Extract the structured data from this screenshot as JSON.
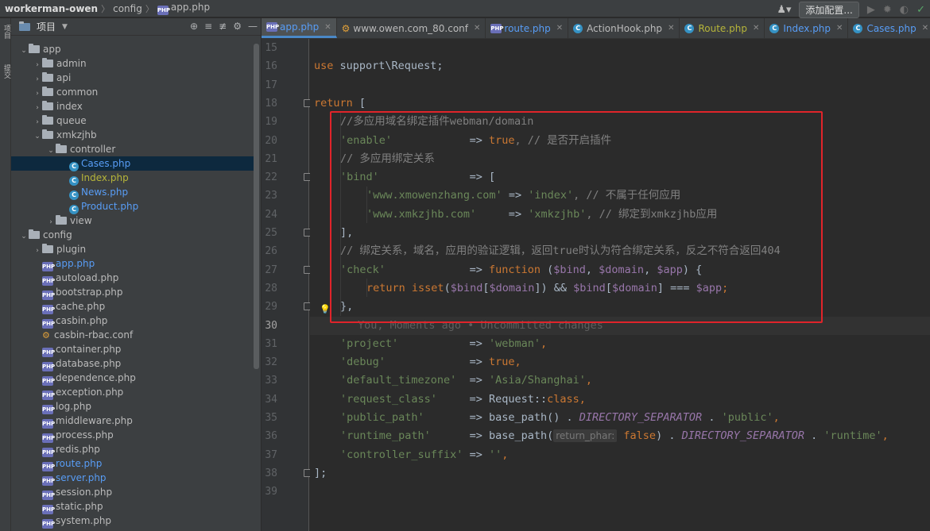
{
  "breadcrumb": [
    "workerman-owen",
    "config",
    "app.php"
  ],
  "toolbar": {
    "add_config_label": "添加配置..."
  },
  "toolstrip": {
    "project_tab": "项目",
    "commit_tab": "提交"
  },
  "project_panel": {
    "title": "项目",
    "tree": [
      {
        "label": "app",
        "type": "folder",
        "depth": 1,
        "expanded": true
      },
      {
        "label": "admin",
        "type": "folder",
        "depth": 2,
        "expanded": false
      },
      {
        "label": "api",
        "type": "folder",
        "depth": 2,
        "expanded": false
      },
      {
        "label": "common",
        "type": "folder",
        "depth": 2,
        "expanded": false
      },
      {
        "label": "index",
        "type": "folder",
        "depth": 2,
        "expanded": false
      },
      {
        "label": "queue",
        "type": "folder",
        "depth": 2,
        "expanded": false
      },
      {
        "label": "xmkzjhb",
        "type": "folder",
        "depth": 2,
        "expanded": true
      },
      {
        "label": "controller",
        "type": "folder",
        "depth": 3,
        "expanded": true
      },
      {
        "label": "Cases.php",
        "type": "class",
        "depth": 4,
        "selected": true,
        "color": "blue"
      },
      {
        "label": "Index.php",
        "type": "class",
        "depth": 4,
        "color": "yellow"
      },
      {
        "label": "News.php",
        "type": "class",
        "depth": 4,
        "color": "blue"
      },
      {
        "label": "Product.php",
        "type": "class",
        "depth": 4,
        "color": "blue"
      },
      {
        "label": "view",
        "type": "folder",
        "depth": 3,
        "expanded": false
      },
      {
        "label": "config",
        "type": "folder",
        "depth": 1,
        "expanded": true
      },
      {
        "label": "plugin",
        "type": "folder",
        "depth": 2,
        "expanded": false
      },
      {
        "label": "app.php",
        "type": "php",
        "depth": 2,
        "color": "blue"
      },
      {
        "label": "autoload.php",
        "type": "php",
        "depth": 2
      },
      {
        "label": "bootstrap.php",
        "type": "php",
        "depth": 2
      },
      {
        "label": "cache.php",
        "type": "php",
        "depth": 2
      },
      {
        "label": "casbin.php",
        "type": "php",
        "depth": 2
      },
      {
        "label": "casbin-rbac.conf",
        "type": "conf",
        "depth": 2
      },
      {
        "label": "container.php",
        "type": "php",
        "depth": 2
      },
      {
        "label": "database.php",
        "type": "php",
        "depth": 2
      },
      {
        "label": "dependence.php",
        "type": "php",
        "depth": 2
      },
      {
        "label": "exception.php",
        "type": "php",
        "depth": 2
      },
      {
        "label": "log.php",
        "type": "php",
        "depth": 2
      },
      {
        "label": "middleware.php",
        "type": "php",
        "depth": 2
      },
      {
        "label": "process.php",
        "type": "php",
        "depth": 2
      },
      {
        "label": "redis.php",
        "type": "php",
        "depth": 2
      },
      {
        "label": "route.php",
        "type": "php",
        "depth": 2,
        "color": "blue"
      },
      {
        "label": "server.php",
        "type": "php",
        "depth": 2,
        "color": "blue"
      },
      {
        "label": "session.php",
        "type": "php",
        "depth": 2
      },
      {
        "label": "static.php",
        "type": "php",
        "depth": 2
      },
      {
        "label": "system.php",
        "type": "php",
        "depth": 2
      }
    ]
  },
  "tabs": [
    {
      "label": "app.php",
      "icon": "php",
      "active": true,
      "color": "blue"
    },
    {
      "label": "www.owen.com_80.conf",
      "icon": "conf",
      "color": "normal"
    },
    {
      "label": "route.php",
      "icon": "php",
      "color": "blue"
    },
    {
      "label": "ActionHook.php",
      "icon": "class",
      "color": "normal"
    },
    {
      "label": "Route.php",
      "icon": "class",
      "color": "olive"
    },
    {
      "label": "Index.php",
      "icon": "class",
      "color": "blue"
    },
    {
      "label": "Cases.php",
      "icon": "class",
      "color": "blue"
    }
  ],
  "editor": {
    "current_line": 30,
    "line_numbers": [
      15,
      16,
      17,
      18,
      19,
      20,
      21,
      22,
      23,
      24,
      25,
      26,
      27,
      28,
      29,
      30,
      31,
      32,
      33,
      34,
      35,
      36,
      37,
      38,
      39
    ],
    "code": {
      "l16_use": "use",
      "l16_ns": " support\\Request;",
      "l18_return": "return",
      "l18_bracket": " [",
      "l19": "//多应用域名绑定插件webman/domain",
      "l20_key": "'enable'",
      "l20_arrow": "            => ",
      "l20_val": "true",
      "l20_cmt": ", // 是否开启插件",
      "l21": "// 多应用绑定关系",
      "l22_key": "'bind'",
      "l22_rest": "              => [",
      "l23_key": "'www.xmowenzhang.com'",
      "l23_arrow": " => ",
      "l23_val": "'index'",
      "l23_cmt": ", // 不属于任何应用",
      "l24_key": "'www.xmkzjhb.com'",
      "l24_arrow": "     => ",
      "l24_val": "'xmkzjhb'",
      "l24_cmt": ", // 绑定到xmkzjhb应用",
      "l25": "],",
      "l26": "// 绑定关系，域名，应用的验证逻辑，返回true时认为符合绑定关系，反之不符合返回404",
      "l27_key": "'check'",
      "l27_arrow": "             => ",
      "l27_fn": "function",
      "l27_open": " (",
      "l27_v1": "$bind",
      "l27_c1": ", ",
      "l27_v2": "$domain",
      "l27_c2": ", ",
      "l27_v3": "$app",
      "l27_close": ") {",
      "l28_return": "return",
      "l28_isset": " isset",
      "l28_a": "(",
      "l28_v1": "$bind",
      "l28_b": "[",
      "l28_v2": "$domain",
      "l28_c": "]) && ",
      "l28_v3": "$bind",
      "l28_d": "[",
      "l28_v4": "$domain",
      "l28_e": "] === ",
      "l28_v5": "$app",
      "l28_f": ";",
      "l29": "},",
      "l30_blame": "You, Moments ago • Uncommitted changes",
      "l31_key": "'project'",
      "l31_arrow": "           => ",
      "l31_val": "'webman'",
      "l31_end": ",",
      "l32_key": "'debug'",
      "l32_arrow": "             => ",
      "l32_val": "true",
      "l32_end": ",",
      "l33_key": "'default_timezone'",
      "l33_arrow": "  => ",
      "l33_val": "'Asia/Shanghai'",
      "l33_end": ",",
      "l34_key": "'request_class'",
      "l34_arrow": "     => ",
      "l34_cls": "Request::",
      "l34_kw": "class",
      "l34_end": ",",
      "l35_key": "'public_path'",
      "l35_arrow": "       => ",
      "l35_fn": "base_path()",
      "l35_dot": " . ",
      "l35_const": "DIRECTORY_SEPARATOR",
      "l35_dot2": " . ",
      "l35_val": "'public'",
      "l35_end": ",",
      "l36_key": "'runtime_path'",
      "l36_arrow": "      => ",
      "l36_fn": "base_path(",
      "l36_hint": "return_phar:",
      "l36_false": " false",
      "l36_close": ")",
      "l36_dot": " . ",
      "l36_const": "DIRECTORY_SEPARATOR",
      "l36_dot2": " . ",
      "l36_val": "'runtime'",
      "l36_end": ",",
      "l37_key": "'controller_suffix'",
      "l37_arrow": " => ",
      "l37_val": "''",
      "l37_end": ",",
      "l38": "];"
    }
  },
  "colors": {
    "highlight_box": "#e0242a",
    "keyword": "#cc7832",
    "string": "#6a8759",
    "comment": "#808080",
    "variable": "#9876aa",
    "function": "#ffc66d"
  }
}
